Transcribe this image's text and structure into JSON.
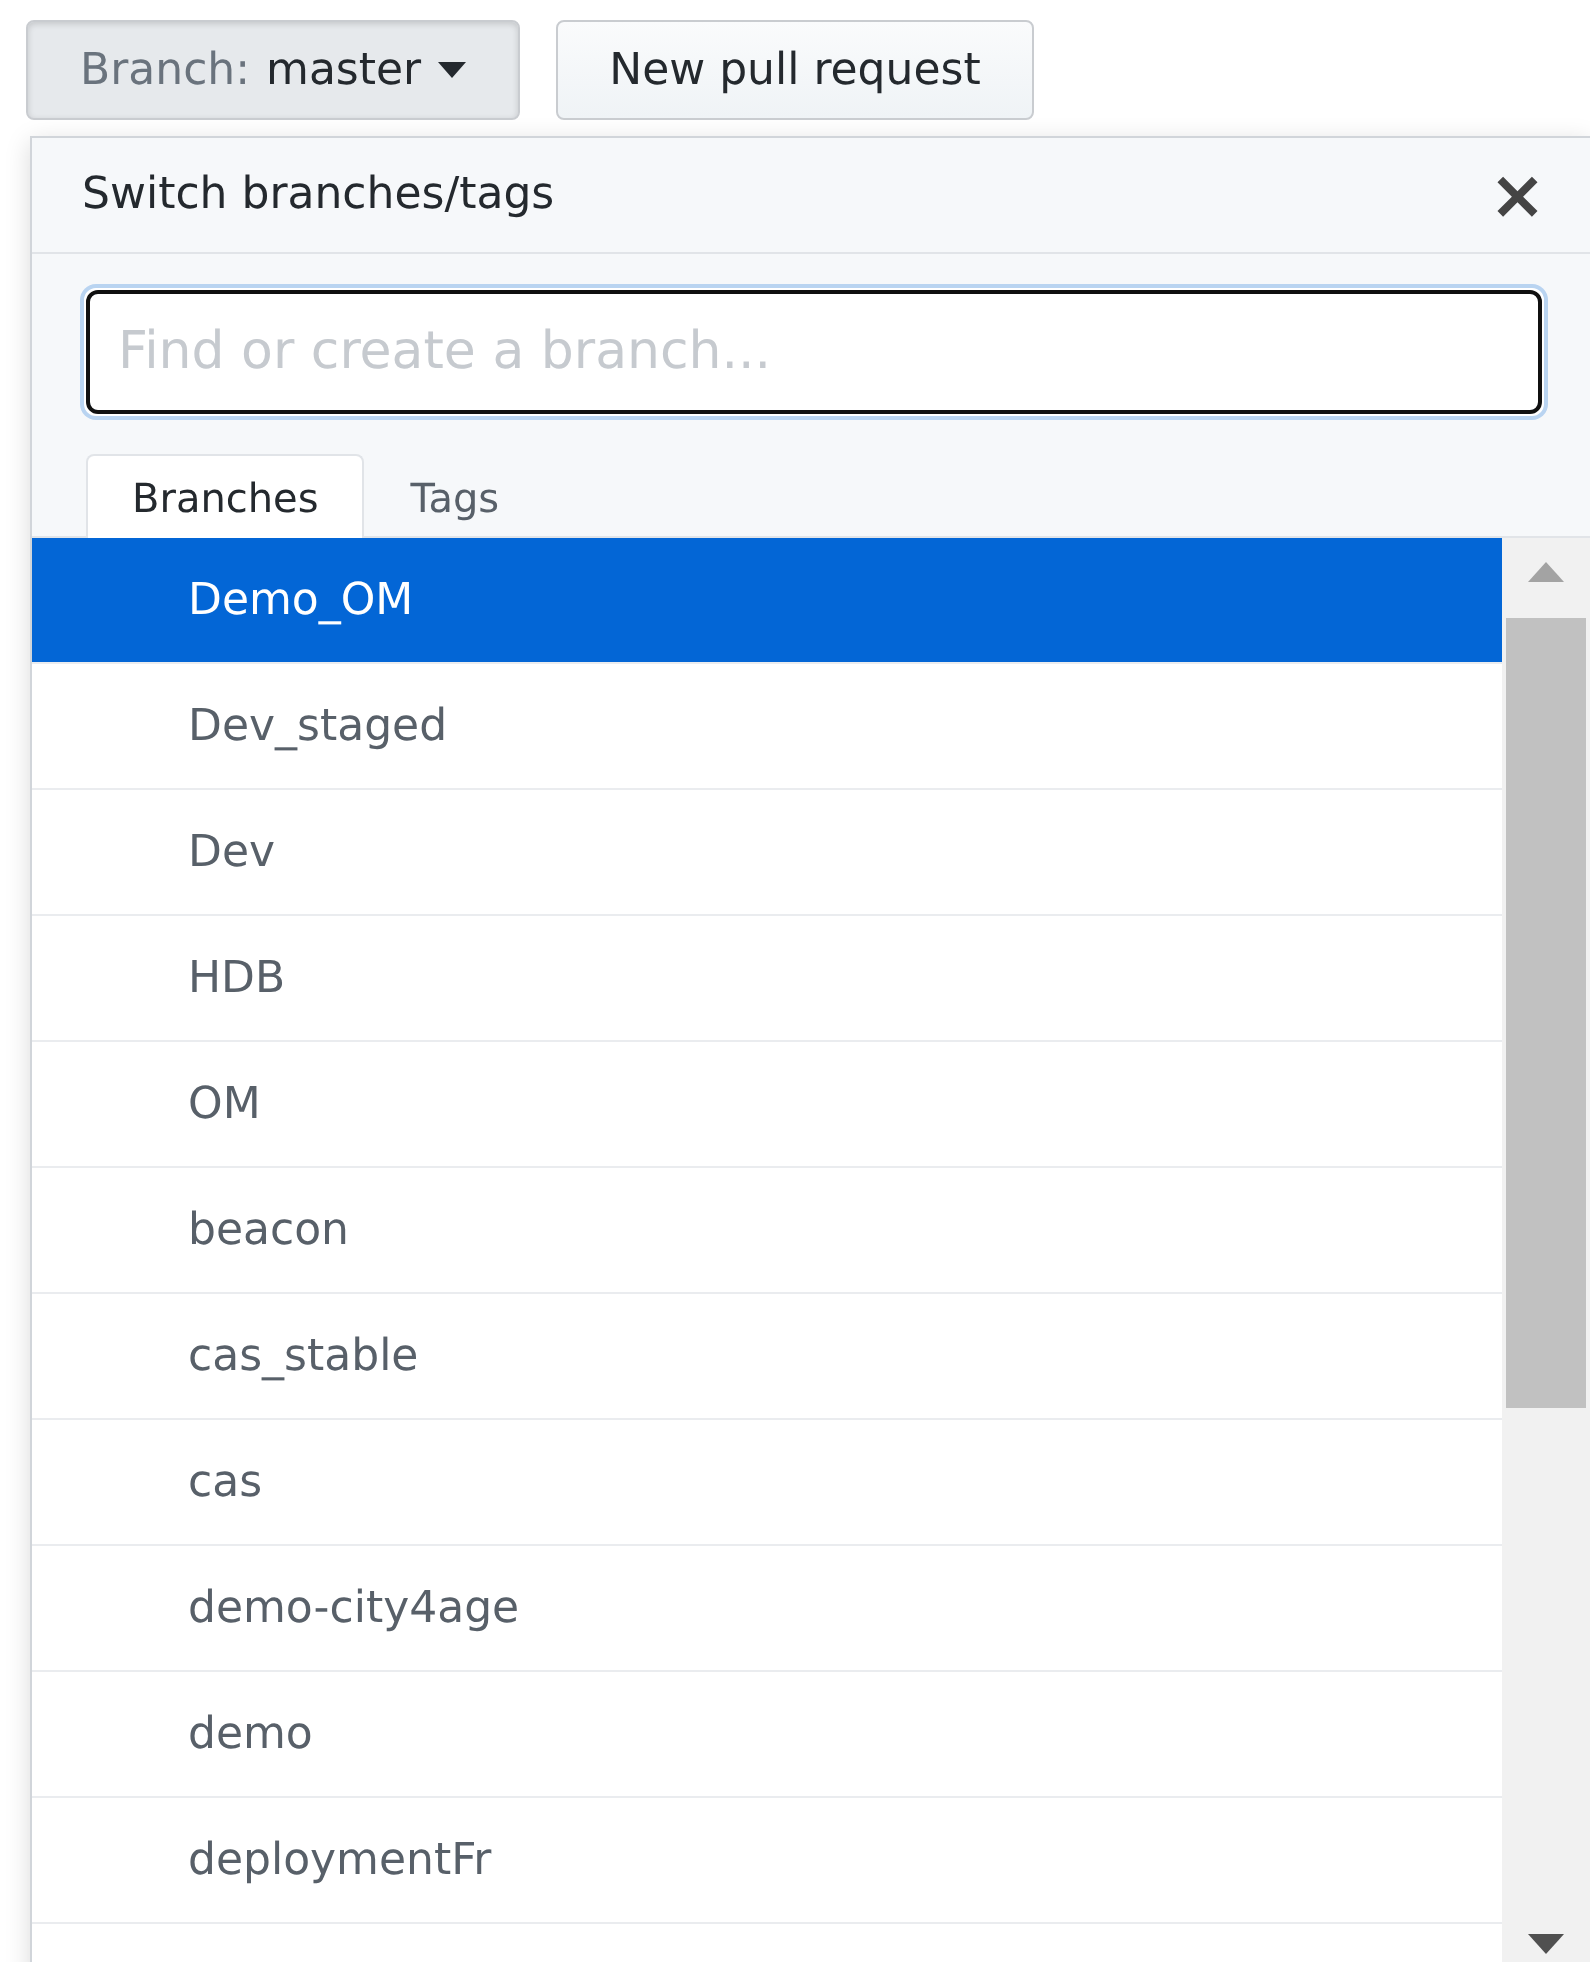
{
  "toolbar": {
    "branch_button": {
      "label": "Branch:",
      "value": "master"
    },
    "new_pull_request": "New pull request"
  },
  "dropdown": {
    "title": "Switch branches/tags",
    "close": "×",
    "search": {
      "placeholder": "Find or create a branch..."
    },
    "tabs": [
      {
        "label": "Branches",
        "selected": true
      },
      {
        "label": "Tags",
        "selected": false
      }
    ],
    "branches": [
      {
        "name": "Demo_OM",
        "selected": true
      },
      {
        "name": "Dev_staged",
        "selected": false
      },
      {
        "name": "Dev",
        "selected": false
      },
      {
        "name": "HDB",
        "selected": false
      },
      {
        "name": "OM",
        "selected": false
      },
      {
        "name": "beacon",
        "selected": false
      },
      {
        "name": "cas_stable",
        "selected": false
      },
      {
        "name": "cas",
        "selected": false
      },
      {
        "name": "demo-city4age",
        "selected": false
      },
      {
        "name": "demo",
        "selected": false
      },
      {
        "name": "deploymentFr",
        "selected": false
      }
    ]
  }
}
